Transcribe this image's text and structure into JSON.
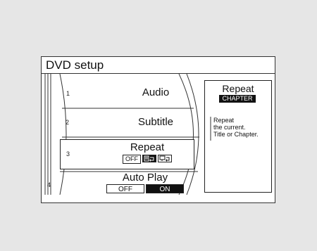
{
  "window": {
    "title": "DVD setup"
  },
  "menu": {
    "items": [
      {
        "number": "1",
        "label": "Audio"
      },
      {
        "number": "2",
        "label": "Subtitle"
      },
      {
        "number": "3",
        "label": "Repeat",
        "options": [
          "OFF"
        ],
        "selected_icon": "repeat-chapter-icon"
      },
      {
        "number": "4",
        "label": "Auto Play",
        "options": [
          "OFF",
          "ON"
        ],
        "selected": "ON"
      }
    ]
  },
  "info_panel": {
    "title": "Repeat",
    "badge": "CHAPTER",
    "description": [
      "Repeat",
      "the current.",
      "Title or Chapter."
    ]
  },
  "colors": {
    "background": "#e6e6e6",
    "panel": "#ffffff",
    "selected": "#111111"
  },
  "icons": [
    "repeat-chapter-icon",
    "repeat-title-icon"
  ]
}
